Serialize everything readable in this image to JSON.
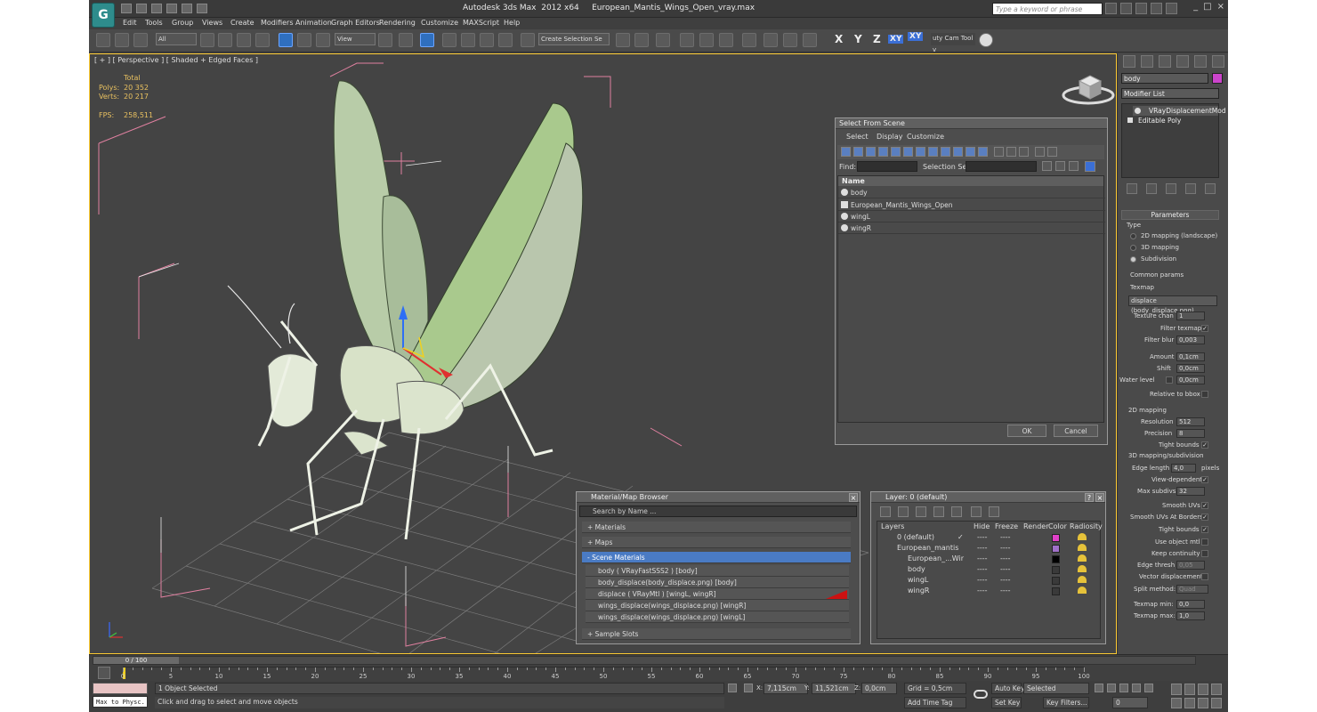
{
  "app": {
    "title": "Autodesk 3ds Max  2012 x64     European_Mantis_Wings_Open_vray.max",
    "search_placeholder": "Type a keyword or phrase",
    "logo": "G",
    "controls": [
      "_",
      "□",
      "×"
    ]
  },
  "menu": [
    "Edit",
    "Tools",
    "Group",
    "Views",
    "Create",
    "Modifiers",
    "Animation",
    "Graph Editors",
    "Rendering",
    "Customize",
    "MAXScript",
    "Help"
  ],
  "toolbar": {
    "filter": "All",
    "refcoord": "View",
    "named_selection": "Create Selection Se",
    "axes": [
      "X",
      "Y",
      "Z",
      "XY",
      "XY"
    ],
    "cam_tool": "uty Cam Tool v"
  },
  "viewport": {
    "label": "[ + ] [ Perspective ] [ Shaded + Edged Faces ]",
    "stats_header": "Total",
    "polys_label": "Polys:",
    "polys": "20 352",
    "verts_label": "Verts:",
    "verts": "20 217",
    "fps_label": "FPS:",
    "fps": "258,511"
  },
  "select_from_scene": {
    "title": "Select From Scene",
    "menu": [
      "Select",
      "Display",
      "Customize"
    ],
    "find_label": "Find:",
    "selset_label": "Selection Set:",
    "column": "Name",
    "items": [
      "body",
      "European_Mantis_Wings_Open",
      "wingL",
      "wingR"
    ],
    "ok": "OK",
    "cancel": "Cancel"
  },
  "material_browser": {
    "title": "Material/Map Browser",
    "search": "Search by Name ...",
    "sections": [
      "+ Materials",
      "+ Maps",
      "- Scene Materials",
      "+ Sample Slots"
    ],
    "scene_materials": [
      "body  ( VRayFastSSS2 ) [body]",
      "body_displace(body_displace.png) [body]",
      "displace  ( VRayMtl ) [wingL, wingR]",
      "wings_displace(wings_displace.png) [wingR]",
      "wings_displace(wings_displace.png) [wingL]"
    ]
  },
  "layer_dialog": {
    "title": "Layer: 0 (default)",
    "buttons": [
      "?",
      "×"
    ],
    "columns": [
      "Layers",
      "Hide",
      "Freeze",
      "Render",
      "Color",
      "Radiosity"
    ],
    "rows": [
      {
        "name": "0 (default)",
        "hide": "----",
        "freeze": "----",
        "color": "#e040c8"
      },
      {
        "name": "European_mantis",
        "hide": "----",
        "freeze": "----",
        "color": "#a070c8"
      },
      {
        "name": "European_...Wir",
        "hide": "----",
        "freeze": "----",
        "color": "#000000"
      },
      {
        "name": "body",
        "hide": "----",
        "freeze": "----",
        "color": "#3a3a3a"
      },
      {
        "name": "wingL",
        "hide": "----",
        "freeze": "----",
        "color": "#3a3a3a"
      },
      {
        "name": "wingR",
        "hide": "----",
        "freeze": "----",
        "color": "#3a3a3a"
      }
    ]
  },
  "command_panel": {
    "object_name": "body",
    "modifier_list": "Modifier List",
    "stack": [
      "VRayDisplacementMod",
      "Editable Poly"
    ],
    "parameters": "Parameters",
    "type_label": "Type",
    "types": [
      "2D mapping (landscape)",
      "3D mapping",
      "Subdivision"
    ],
    "common_params": "Common params",
    "texmap_label": "Texmap",
    "texmap": "displace (body_displace.png)",
    "texture_chan_label": "Texture chan",
    "texture_chan": "1",
    "filter_texmap": "Filter texmap",
    "filter_blur_label": "Filter blur",
    "filter_blur": "0,003",
    "amount_label": "Amount",
    "amount": "0,1cm",
    "shift_label": "Shift",
    "shift": "0,0cm",
    "water_level_label": "Water level",
    "water_level": "0,0cm",
    "relative_bbox": "Relative to bbox",
    "mapping2d": "2D mapping",
    "resolution_label": "Resolution",
    "resolution": "512",
    "precision_label": "Precision",
    "precision": "8",
    "tight_bounds": "Tight bounds",
    "mapping3d": "3D mapping/subdivision",
    "edge_length_label": "Edge length",
    "edge_length": "4,0",
    "pixels": "pixels",
    "view_dependent": "View-dependent",
    "max_subdivs_label": "Max subdivs",
    "max_subdivs": "32",
    "smooth_uvs": "Smooth UVs",
    "smooth_uvs_borders": "Smooth UVs At Borders",
    "tight_bounds2": "Tight bounds",
    "use_object_mtl": "Use object mtl",
    "keep_continuity": "Keep continuity",
    "edge_thresh_label": "Edge thresh",
    "edge_thresh": "0,05",
    "vector_displacement": "Vector displacement",
    "split_method_label": "Split method:",
    "split_method": "Quad",
    "texmap_min_label": "Texmap min:",
    "texmap_min": "0,0",
    "texmap_max_label": "Texmap max:",
    "texmap_max": "1,0"
  },
  "timeline": {
    "frame": "0 / 100",
    "ticks": [
      "0",
      "5",
      "10",
      "15",
      "20",
      "25",
      "30",
      "35",
      "40",
      "45",
      "50",
      "55",
      "60",
      "65",
      "70",
      "75",
      "80",
      "85",
      "90",
      "95",
      "100"
    ]
  },
  "status": {
    "maxscript": "Max to Physc.",
    "selected": "1 Object Selected",
    "prompt": "Click and drag to select and move objects",
    "x_label": "X:",
    "x": "7,115cm",
    "y_label": "Y:",
    "y": "11,521cm",
    "z_label": "Z:",
    "z": "0,0cm",
    "grid": "Grid = 0,5cm",
    "add_time_tag": "Add Time Tag",
    "auto_key": "Auto Key",
    "set_key": "Set Key",
    "selected_dd": "Selected",
    "key_filters": "Key Filters...",
    "frame_field": "0"
  }
}
